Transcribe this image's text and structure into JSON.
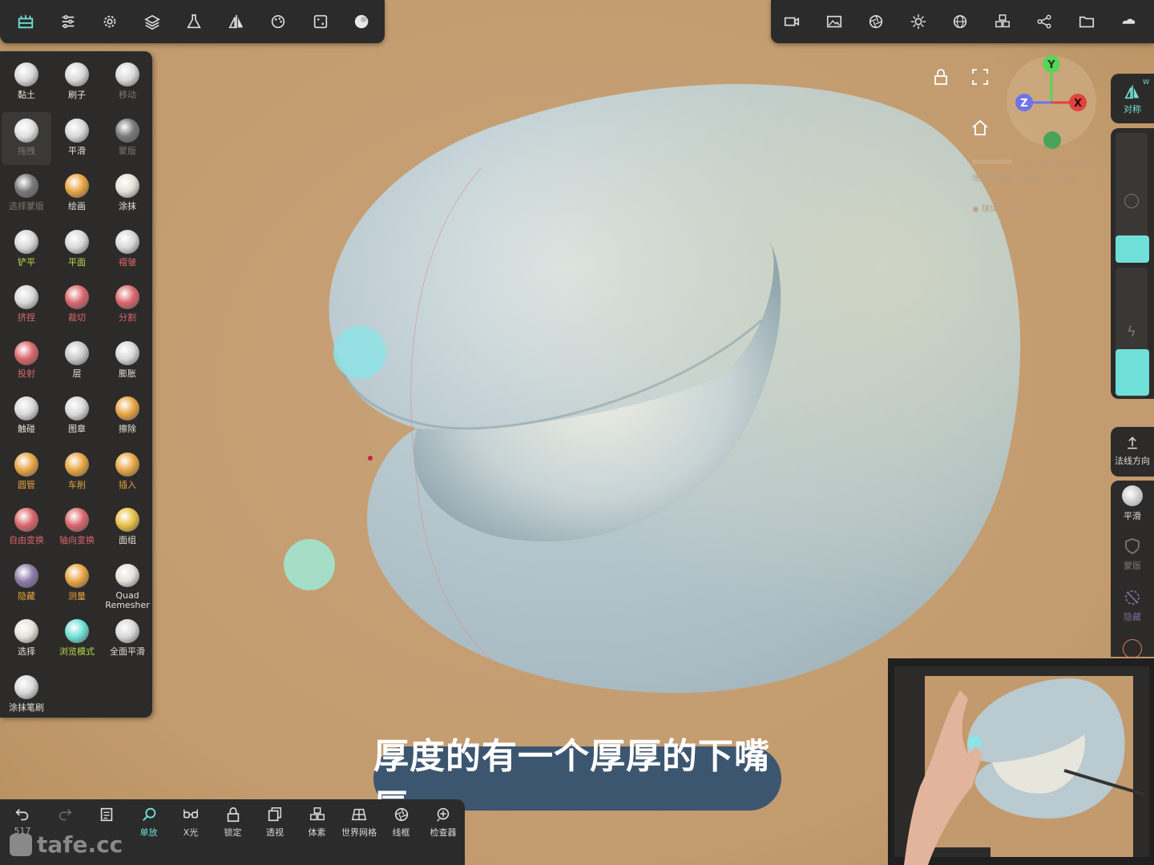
{
  "top_left_icons": [
    "scene-icon",
    "settings-sliders-icon",
    "gear-icon",
    "layers-icon",
    "flask-icon",
    "symmetry-icon",
    "palette-icon",
    "dice-icon",
    "matcap-sphere-icon"
  ],
  "top_right_icons": [
    "camera-icon",
    "image-icon",
    "aperture-icon",
    "sun-icon",
    "grid-sphere-icon",
    "voxel-icon",
    "share-icon",
    "folder-icon",
    "cloud-icon"
  ],
  "tools": [
    {
      "label": "黏土",
      "style": "lit"
    },
    {
      "label": "刷子",
      "style": "lit"
    },
    {
      "label": "移动",
      "style": "dim"
    },
    {
      "label": "拖拽",
      "style": "dim"
    },
    {
      "label": "平滑",
      "style": "lit"
    },
    {
      "label": "蒙版",
      "style": "dim"
    },
    {
      "label": "选择蒙版",
      "style": "dim"
    },
    {
      "label": "绘画",
      "style": "lit"
    },
    {
      "label": "涂抹",
      "style": "lit"
    },
    {
      "label": "铲平",
      "style": "green"
    },
    {
      "label": "平面",
      "style": "green"
    },
    {
      "label": "褶皱",
      "style": "red"
    },
    {
      "label": "挤捏",
      "style": "red"
    },
    {
      "label": "裁切",
      "style": "red"
    },
    {
      "label": "分割",
      "style": "red"
    },
    {
      "label": "投射",
      "style": "red"
    },
    {
      "label": "层",
      "style": "lit"
    },
    {
      "label": "膨胀",
      "style": "lit"
    },
    {
      "label": "触碰",
      "style": "lit"
    },
    {
      "label": "图章",
      "style": "lit"
    },
    {
      "label": "擦除",
      "style": "lit"
    },
    {
      "label": "圆管",
      "style": "orange"
    },
    {
      "label": "车削",
      "style": "orange"
    },
    {
      "label": "插入",
      "style": "orange"
    },
    {
      "label": "自由变换",
      "style": "red"
    },
    {
      "label": "轴向变换",
      "style": "red"
    },
    {
      "label": "面组",
      "style": "lit"
    },
    {
      "label": "隐藏",
      "style": "orange"
    },
    {
      "label": "测量",
      "style": "orange"
    },
    {
      "label": "Quad\nRemesher",
      "style": "lit"
    },
    {
      "label": "选择",
      "style": "lit"
    },
    {
      "label": "浏览模式",
      "style": "green"
    },
    {
      "label": "全面平滑",
      "style": "lit"
    },
    {
      "label": "涂抹笔刷",
      "style": "lit"
    }
  ],
  "gizmo": {
    "y": "Y",
    "x": "X",
    "z": "Z",
    "w": "W"
  },
  "stats": {
    "memory": "325 MB / 16.4 GB",
    "scene_vertices": "场景顶点数：6640 · ⊘ 7486",
    "object": "球体 · 2326"
  },
  "right_panel": {
    "symmetry_label": "对称",
    "normal_label": "法线方向",
    "smooth_label": "平滑",
    "mask_label": "蒙版",
    "hide_label": "隐藏"
  },
  "bottom_bar": [
    {
      "label": "517",
      "icon": "undo-icon"
    },
    {
      "label": "",
      "icon": "redo-icon"
    },
    {
      "label": "",
      "icon": "notes-icon"
    },
    {
      "label": "单放",
      "icon": "search-icon"
    },
    {
      "label": "X光",
      "icon": "xray-glasses-icon"
    },
    {
      "label": "锁定",
      "icon": "lock-icon"
    },
    {
      "label": "透视",
      "icon": "perspective-icon"
    },
    {
      "label": "体素",
      "icon": "voxel-icon"
    },
    {
      "label": "世界网格",
      "icon": "world-grid-icon"
    },
    {
      "label": "线框",
      "icon": "wireframe-icon"
    },
    {
      "label": "检查器",
      "icon": "inspector-icon"
    }
  ],
  "watermark": "tafe.cc",
  "subtitle": "厚度的有一个厚厚的下嘴唇",
  "colors": {
    "accent": "#6fe0d8",
    "toolbar": "#2b2b2b",
    "background": "#c69f73",
    "subtitle_bg": "#3c5670"
  }
}
